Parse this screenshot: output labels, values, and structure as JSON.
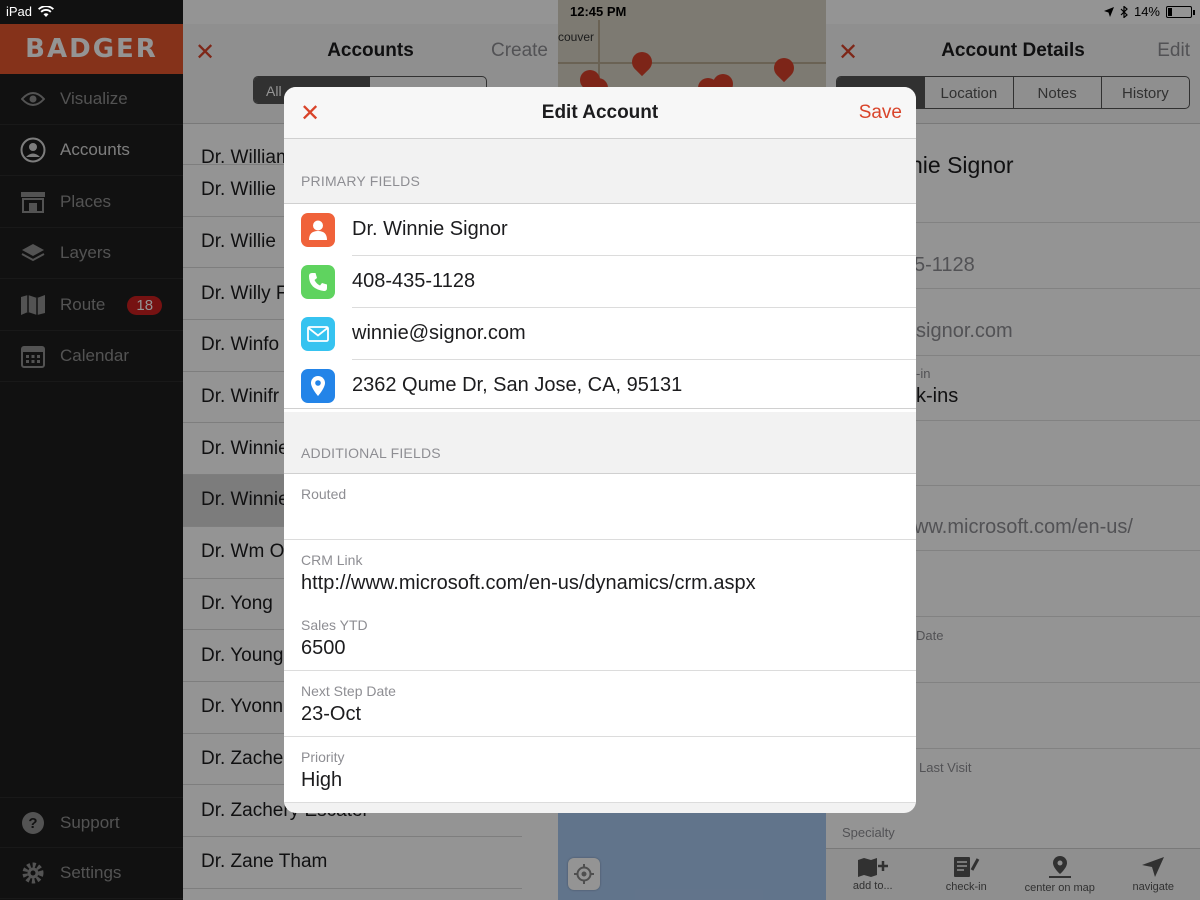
{
  "status_bar": {
    "device": "iPad",
    "time": "12:45 PM",
    "battery": "14%"
  },
  "sidebar": {
    "brand": "BADGER",
    "items": [
      {
        "label": "Visualize",
        "icon": "eye-icon"
      },
      {
        "label": "Accounts",
        "icon": "person-circle-icon"
      },
      {
        "label": "Places",
        "icon": "store-icon"
      },
      {
        "label": "Layers",
        "icon": "layers-icon"
      },
      {
        "label": "Route",
        "icon": "map-icon",
        "badge": "18"
      },
      {
        "label": "Calendar",
        "icon": "calendar-icon"
      }
    ],
    "footer": [
      {
        "label": "Support",
        "icon": "help-icon"
      },
      {
        "label": "Settings",
        "icon": "gear-icon"
      }
    ]
  },
  "accounts": {
    "title": "Accounts",
    "create_label": "Create",
    "segment_label": "All",
    "rows": [
      "Dr. William",
      "Dr. Willie",
      "Dr. Willie",
      "Dr. Willy F",
      "Dr. Winfo",
      "Dr. Winifr",
      "Dr. Winnie",
      "Dr. Winnie",
      "Dr. Wm O",
      "Dr. Yong",
      "Dr. Young",
      "Dr. Yvonn",
      "Dr. Zache",
      "Dr. Zachery Escatel",
      "Dr. Zane Tham"
    ]
  },
  "map": {
    "city_label": "couver"
  },
  "details": {
    "title": "Account Details",
    "edit_label": "Edit",
    "tabs": [
      "",
      "Location",
      "Notes",
      "History"
    ],
    "name": "nie Signor",
    "phone": "5-1128",
    "email": "signor.com",
    "checkin_label": "-in",
    "checkins": "k-ins",
    "website": "ww.microsoft.com/en-us/",
    "date_label": "Date",
    "last_visit_label": "Last Visit",
    "specialty_label": "Specialty",
    "toolbar": [
      {
        "label": "add to...",
        "icon": "add-to-map-icon"
      },
      {
        "label": "check-in",
        "icon": "check-in-icon"
      },
      {
        "label": "center on map",
        "icon": "center-on-map-icon"
      },
      {
        "label": "navigate",
        "icon": "navigate-icon"
      }
    ]
  },
  "modal": {
    "title": "Edit Account",
    "save_label": "Save",
    "primary_label": "PRIMARY FIELDS",
    "primary_fields": [
      {
        "value": "Dr. Winnie Signor",
        "icon": "person-icon",
        "color": "#f0623a"
      },
      {
        "value": "408-435-1128",
        "icon": "phone-icon",
        "color": "#5fd35f"
      },
      {
        "value": "winnie@signor.com",
        "icon": "mail-icon",
        "color": "#36c3f0"
      },
      {
        "value": "2362 Qume Dr, San Jose, CA, 95131",
        "icon": "location-pin-icon",
        "color": "#2384e8"
      }
    ],
    "additional_label": "ADDITIONAL FIELDS",
    "additional_fields": [
      {
        "label": "Routed",
        "value": ""
      },
      {
        "label": "CRM Link",
        "value": "http://www.microsoft.com/en-us/dynamics/crm.aspx"
      },
      {
        "label": "Sales YTD",
        "value": "6500"
      },
      {
        "label": "Next Step Date",
        "value": "23-Oct"
      },
      {
        "label": "Priority",
        "value": "High"
      }
    ]
  },
  "colors": {
    "accent": "#d9442a",
    "brand": "#e5562e"
  }
}
